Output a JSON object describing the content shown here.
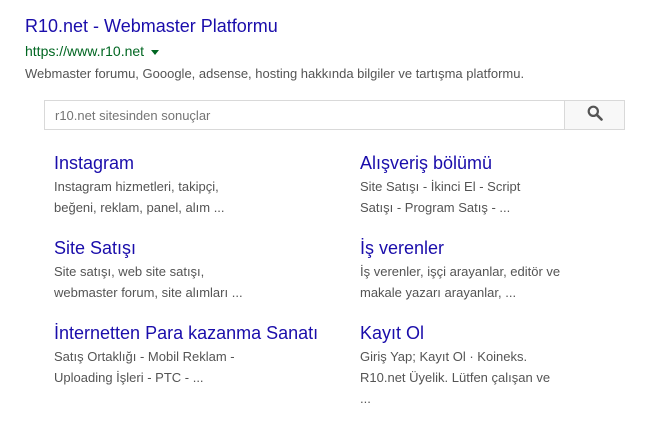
{
  "result": {
    "title": "R10.net - Webmaster Platformu",
    "url": "https://www.r10.net",
    "snippet": "Webmaster forumu, Gooogle, adsense, hosting hakkında bilgiler ve tartışma platformu."
  },
  "sitesearch": {
    "placeholder": "r10.net sitesinden sonuçlar",
    "button_icon": "search-icon"
  },
  "sitelinks": [
    {
      "title": "Instagram",
      "line1": "Instagram hizmetleri, takipçi,",
      "line2": "beğeni, reklam, panel, alım ..."
    },
    {
      "title": "Alışveriş bölümü",
      "line1": "Site Satışı - İkinci El - Script",
      "line2": "Satışı - Program Satış - ..."
    },
    {
      "title": "Site Satışı",
      "line1": "Site satışı, web site satışı,",
      "line2": "webmaster forum, site alımları ..."
    },
    {
      "title": "İş verenler",
      "line1": "İş verenler, işçi arayanlar, editör ve",
      "line2": "makale yazarı arayanlar, ..."
    },
    {
      "title": "İnternetten Para kazanma Sanatı",
      "line1": "Satış Ortaklığı - Mobil Reklam -",
      "line2": "Uploading İşleri - PTC - ..."
    },
    {
      "title": "Kayıt Ol",
      "line1": "Giriş Yap; Kayıt Ol · Koineks.",
      "line2": "R10.net Üyelik. Lütfen çalışan ve",
      "line3": "..."
    }
  ]
}
